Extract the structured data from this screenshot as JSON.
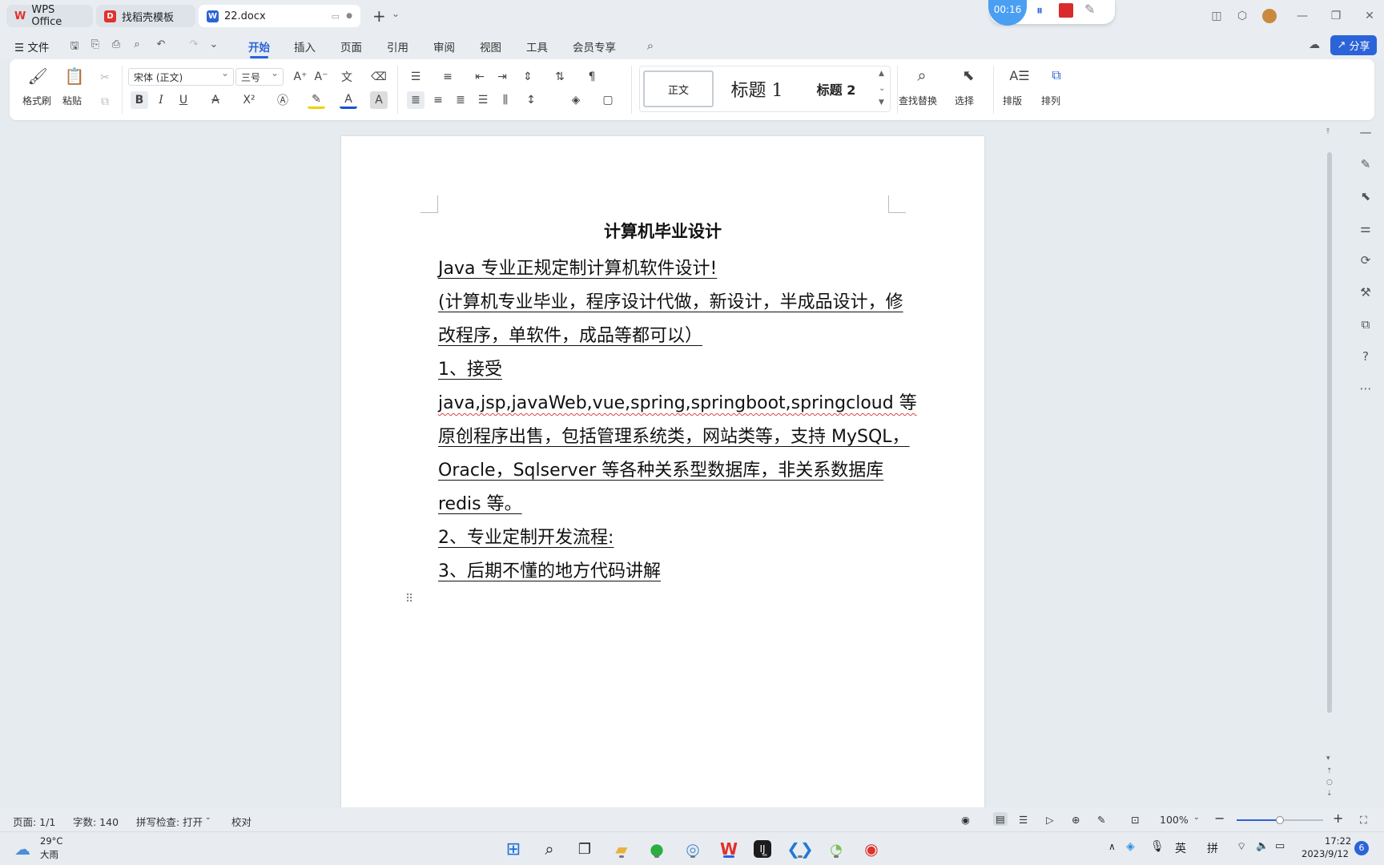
{
  "titlebar": {
    "tabs": [
      {
        "label": "WPS Office",
        "active": false
      },
      {
        "label": "找稻壳模板",
        "active": false
      },
      {
        "label": "22.docx",
        "active": true
      }
    ],
    "new_tab": "+",
    "new_tab_menu": "⌄"
  },
  "recorder": {
    "time": "00:16"
  },
  "menubar": {
    "file_label": "文件",
    "items": [
      "开始",
      "插入",
      "页面",
      "引用",
      "审阅",
      "视图",
      "工具",
      "会员专享"
    ],
    "active": "开始",
    "share_label": "分享"
  },
  "ribbon": {
    "format_painter": "格式刷",
    "paste": "粘贴",
    "font_name": "宋体 (正文)",
    "font_size": "三号",
    "styles": {
      "normal": "正文",
      "heading1": "标题 1",
      "heading2": "标题 2"
    },
    "find_replace": "查找替换",
    "select": "选择",
    "layout": "排版",
    "arrange": "排列"
  },
  "document": {
    "title": "计算机毕业设计",
    "lines": [
      "Java 专业正规定制计算机软件设计!",
      "(计算机专业毕业，程序设计代做，新设计，半成品设计，修",
      "改程序，单软件，成品等都可以）",
      "1、接受",
      "java,jsp,javaWeb,vue,spring,springboot,springcloud 等",
      "原创程序出售，包括管理系统类，网站类等，支持 MySQL，",
      "Oracle，Sqlserver 等各种关系型数据库，非关系数据库",
      "redis 等。",
      "2、专业定制开发流程:",
      "3、后期不懂的地方代码讲解"
    ]
  },
  "statusbar": {
    "page": "页面: 1/1",
    "words": "字数: 140",
    "spellcheck": "拼写检查: 打开",
    "proofread": "校对",
    "zoom": "100%",
    "zoom_level": 0.5
  },
  "taskbar": {
    "weather_temp": "29°C",
    "weather_desc": "大雨",
    "ime_lang": "英",
    "ime_mode": "拼",
    "time": "17:22",
    "date": "2023/9/12",
    "notifications": "6"
  },
  "colors": {
    "accent": "#2b63d9",
    "wps_red": "#e0312c",
    "recorder_red": "#d92b2b"
  }
}
